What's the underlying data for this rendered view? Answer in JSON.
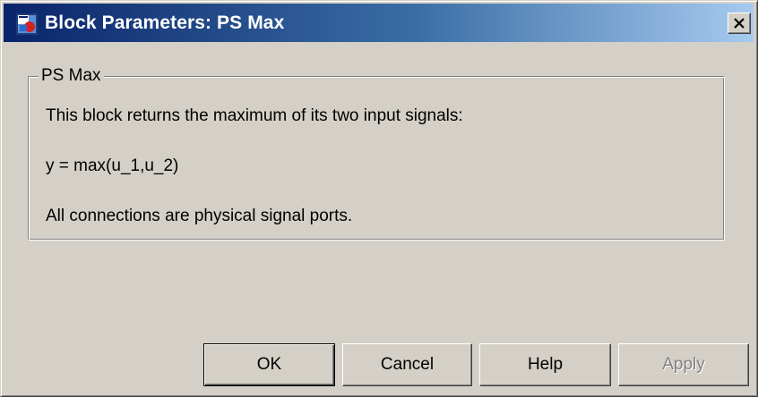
{
  "window": {
    "title": "Block Parameters: PS Max",
    "app_icon": "simulink-block-icon",
    "close_icon": "close-icon"
  },
  "group": {
    "title": "PS Max",
    "description": [
      "This block returns the maximum of its two input signals:",
      "y = max(u_1,u_2)",
      "All connections are physical signal ports."
    ]
  },
  "buttons": {
    "ok": "OK",
    "cancel": "Cancel",
    "help": "Help",
    "apply": "Apply"
  }
}
